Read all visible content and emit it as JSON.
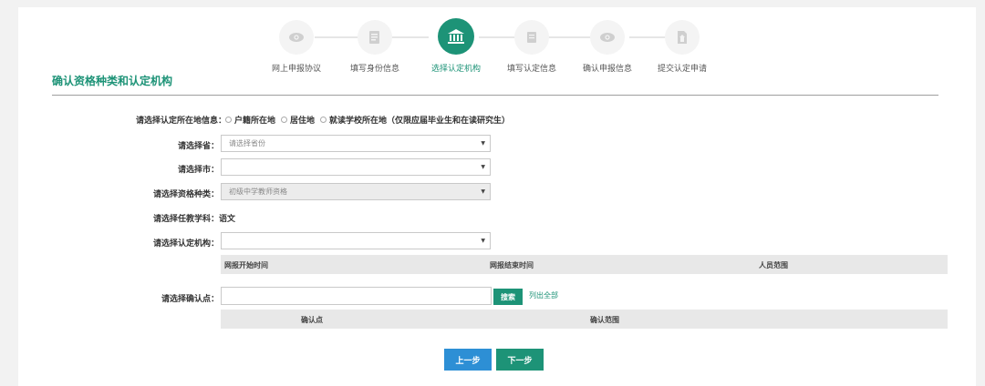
{
  "steps": [
    {
      "label": "网上申报协议",
      "icon": "eye-icon"
    },
    {
      "label": "填写身份信息",
      "icon": "document-icon"
    },
    {
      "label": "选择认定机构",
      "icon": "institution-icon",
      "active": true
    },
    {
      "label": "填写认定信息",
      "icon": "form-icon"
    },
    {
      "label": "确认申报信息",
      "icon": "eye-icon"
    },
    {
      "label": "提交认定申请",
      "icon": "submit-icon"
    }
  ],
  "colors": {
    "accent": "#1d9377",
    "primary_blue": "#2d8fd5"
  },
  "page_title": "确认资格种类和认定机构",
  "location": {
    "label": "请选择认定所在地信息：",
    "options": [
      "户籍所在地",
      "居住地",
      "就读学校所在地（仅限应届毕业生和在读研究生）"
    ]
  },
  "province": {
    "label": "请选择省：",
    "value": "请选择省份"
  },
  "city": {
    "label": "请选择市：",
    "value": ""
  },
  "qualification": {
    "label": "请选择资格种类：",
    "value": "初级中学教师资格"
  },
  "subject": {
    "label": "请选择任教学科：",
    "value": "语文"
  },
  "agency": {
    "label": "请选择认定机构：",
    "value": "",
    "columns": [
      "网报开始时间",
      "网报结束时间",
      "人员范围"
    ]
  },
  "confirm_point": {
    "label": "请选择确认点：",
    "value": "",
    "search_label": "搜索",
    "list_all_label": "列出全部",
    "columns": [
      "确认点",
      "确认范围"
    ]
  },
  "buttons": {
    "prev": "上一步",
    "next": "下一步"
  }
}
